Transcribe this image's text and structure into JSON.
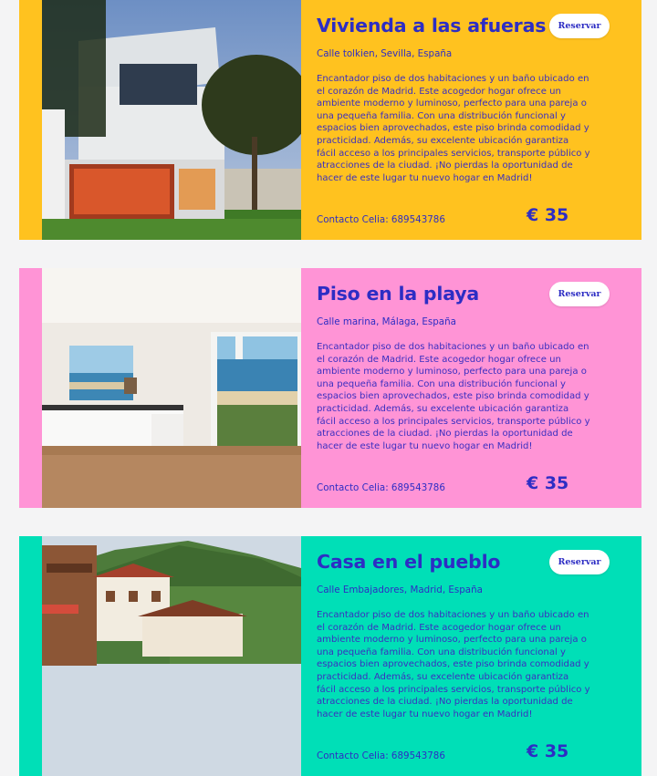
{
  "listings": [
    {
      "title": "Vivienda a las afueras",
      "address": "Calle tolkien, Sevilla, España",
      "description": "Encantador piso de dos habitaciones y un baño ubicado en el corazón de Madrid. Este acogedor hogar ofrece un ambiente moderno y luminoso, perfecto para una pareja o una pequeña familia. Con una distribución funcional y espacios bien aprovechados, este piso brinda comodidad y practicidad. Además, su excelente ubicación garantiza fácil acceso a los principales servicios, transporte público y atracciones de la ciudad. ¡No pierdas la oportunidad de hacer de este lugar tu nuevo hogar en Madrid!",
      "contact": "Contacto Celia: 689543786",
      "price": "€ 35",
      "button": "Reservar",
      "color": "#ffc21f",
      "image": "modern-house-photo"
    },
    {
      "title": "Piso en la playa",
      "address": "Calle marina, Málaga, España",
      "description": "Encantador piso de dos habitaciones y un baño ubicado en el corazón de Madrid. Este acogedor hogar ofrece un ambiente moderno y luminoso, perfecto para una pareja o una pequeña familia. Con una distribución funcional y espacios bien aprovechados, este piso brinda comodidad y practicidad. Además, su excelente ubicación garantiza fácil acceso a los principales servicios, transporte público y atracciones de la ciudad. ¡No pierdas la oportunidad de hacer de este lugar tu nuevo hogar en Madrid!",
      "contact": "Contacto Celia: 689543786",
      "price": "€ 35",
      "button": "Reservar",
      "color": "#ff94d6",
      "image": "beach-apartment-photo"
    },
    {
      "title": "Casa en el pueblo",
      "address": "Calle Embajadores, Madrid, España",
      "description": "Encantador piso de dos habitaciones y un baño ubicado en el corazón de Madrid. Este acogedor hogar ofrece un ambiente moderno y luminoso, perfecto para una pareja o una pequeña familia. Con una distribución funcional y espacios bien aprovechados, este piso brinda comodidad y practicidad. Además, su excelente ubicación garantiza fácil acceso a los principales servicios, transporte público y atracciones de la ciudad. ¡No pierdas la oportunidad de hacer de este lugar tu nuevo hogar en Madrid!",
      "contact": "Contacto Celia: 689543786",
      "price": "€ 35",
      "button": "Reservar",
      "color": "#00dfb7",
      "image": "village-house-photo"
    }
  ]
}
